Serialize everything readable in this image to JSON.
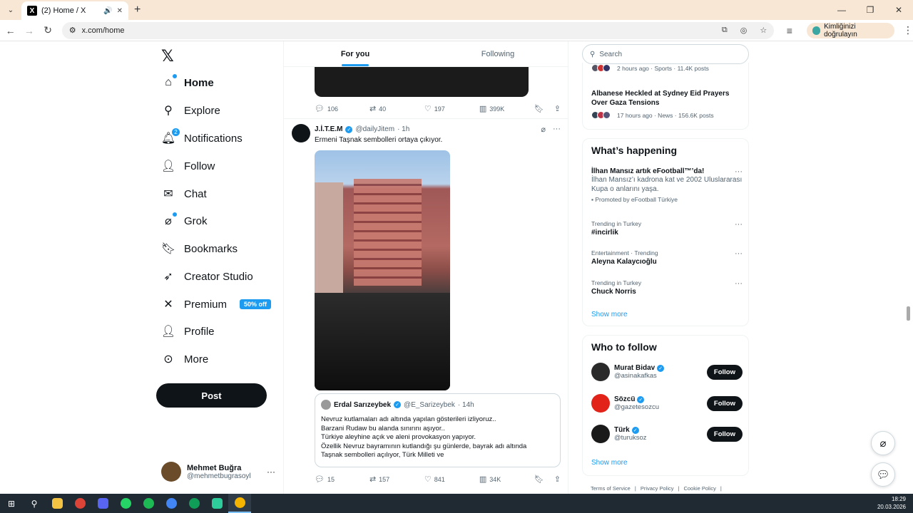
{
  "browser": {
    "tab_title": "(2) Home / X",
    "url": "x.com/home",
    "verify_label": "Kimliğinizi doğrulayın"
  },
  "sidebar": {
    "logo": "𝕏",
    "items": [
      {
        "label": "Home",
        "icon": "home-icon"
      },
      {
        "label": "Explore",
        "icon": "search-icon"
      },
      {
        "label": "Notifications",
        "icon": "bell-icon",
        "badge": "2"
      },
      {
        "label": "Follow",
        "icon": "person-add-icon"
      },
      {
        "label": "Chat",
        "icon": "mail-icon"
      },
      {
        "label": "Grok",
        "icon": "grok-icon"
      },
      {
        "label": "Bookmarks",
        "icon": "bookmark-icon"
      },
      {
        "label": "Creator Studio",
        "icon": "rocket-icon"
      },
      {
        "label": "Premium",
        "icon": "x-logo-icon",
        "badge": "50% off"
      },
      {
        "label": "Profile",
        "icon": "person-icon"
      },
      {
        "label": "More",
        "icon": "more-circle-icon"
      }
    ],
    "post_label": "Post",
    "user": {
      "name": "Mehmet Buğra",
      "handle": "@mehmetbugrasoyl"
    }
  },
  "feed": {
    "tabs": [
      "For you",
      "Following"
    ],
    "prev_actions": {
      "replies": "106",
      "reposts": "40",
      "likes": "197",
      "views": "399K"
    },
    "tweet": {
      "name": "J.İ.T.E.M",
      "handle": "@dailyJitem",
      "time": "· 1h",
      "text": "Ermeni Taşnak sembolleri ortaya çıkıyor.",
      "quote": {
        "name": "Erdal Sarızeybek",
        "handle": "@E_Sarizeybek",
        "time": "· 14h",
        "text": "Nevruz kutlamaları adı altında yapılan gösterileri izliyoruz..\nBarzani Rudaw bu alanda sınırını aşıyor..\nTürkiye aleyhine açık ve aleni provokasyon yapıyor.\nÖzellik Nevruz bayramının kutlandığı şu günlerde, bayrak adı altında\nTaşnak sembolleri açılıyor, Türk Milleti ve"
      },
      "actions": {
        "replies": "15",
        "reposts": "157",
        "likes": "841",
        "views": "34K"
      }
    }
  },
  "right": {
    "search_placeholder": "Search",
    "news_top_meta": "2 hours ago · Sports · 11.4K posts",
    "news2": {
      "title": "Albanese Heckled at Sydney Eid Prayers Over Gaza Tensions",
      "meta": "17 hours ago · News · 156.6K posts"
    },
    "happening_title": "What’s happening",
    "promo": {
      "title": "İlhan Mansız artık eFootball™’da!",
      "desc": "İlhan Mansız’ı kadrona kat ve 2002 Uluslararası Kupa o anlarını yaşa.",
      "by": "Promoted by eFootball Türkiye"
    },
    "trends": [
      {
        "category": "Trending in Turkey",
        "title": "#incirlik"
      },
      {
        "category": "Entertainment · Trending",
        "title": "Aleyna Kalaycıoğlu"
      },
      {
        "category": "Trending in Turkey",
        "title": "Chuck Norris"
      }
    ],
    "show_more": "Show more",
    "wtf_title": "Who to follow",
    "follow_label": "Follow",
    "wtf": [
      {
        "name": "Murat Bidav",
        "handle": "@asinakafkas",
        "color": "#2a2a2a"
      },
      {
        "name": "Sözcü",
        "handle": "@gazetesozcu",
        "color": "#e2231a"
      },
      {
        "name": "Türk",
        "handle": "@turuksoz",
        "color": "#1a1a1a"
      }
    ],
    "footer": [
      "Terms of Service",
      "|",
      "Privacy Policy",
      "|",
      "Cookie Policy",
      "|"
    ]
  },
  "taskbar": {
    "time": "18:29",
    "date": "20.03.2026"
  }
}
